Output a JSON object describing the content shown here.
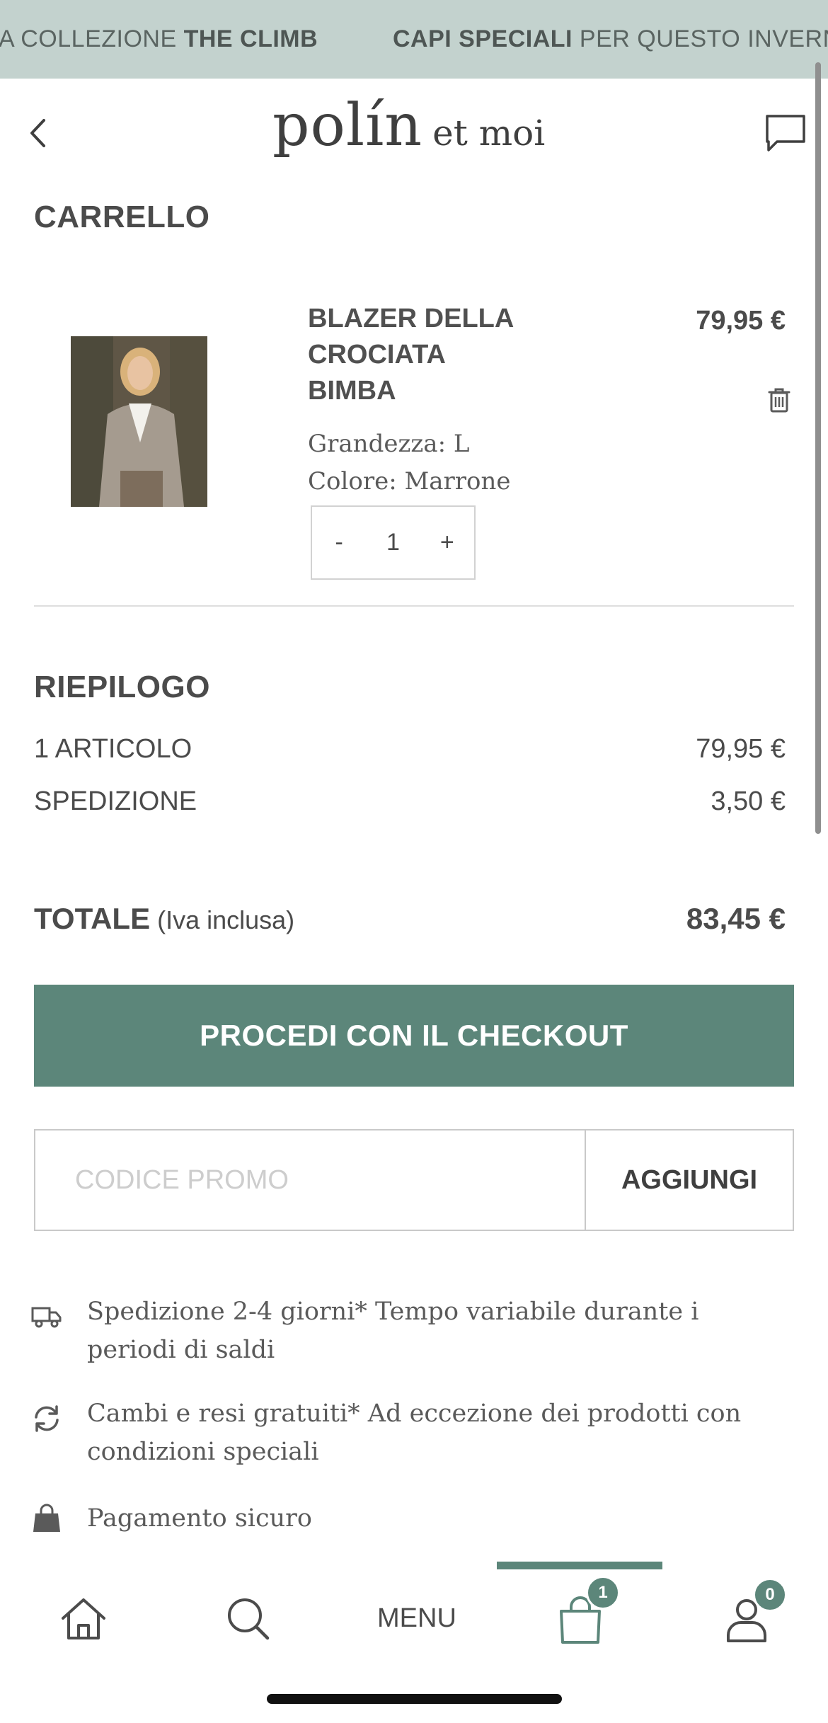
{
  "banner": {
    "left_prefix": "A COLLEZIONE ",
    "left_bold": "THE CLIMB",
    "right_bold": "CAPI SPECIALI",
    "right_suffix": " PER QUESTO INVERNO"
  },
  "header": {
    "logo_main": "polín",
    "logo_sub": "et moi"
  },
  "cart": {
    "title": "CARRELLO",
    "item": {
      "name": "BLAZER DELLA CROCIATA BIMBA",
      "price": "79,95 €",
      "size": "Grandezza: L",
      "color": "Colore: Marrone",
      "qty_minus": "-",
      "qty": "1",
      "qty_plus": "+"
    }
  },
  "summary": {
    "title": "RIEPILOGO",
    "items_label": "1 ARTICOLO",
    "items_value": "79,95 €",
    "shipping_label": "SPEDIZIONE",
    "shipping_value": "3,50 €",
    "total_label": "TOTALE",
    "total_note": " (Iva inclusa)",
    "total_value": "83,45 €"
  },
  "checkout": {
    "label": "PROCEDI CON IL CHECKOUT"
  },
  "promo": {
    "placeholder": "CODICE PROMO",
    "button": "AGGIUNGI"
  },
  "info": {
    "shipping": "Spedizione 2-4 giorni* Tempo variabile durante i periodi di saldi",
    "returns": "Cambi e resi gratuiti* Ad eccezione dei prodotti con condizioni speciali",
    "payment": "Pagamento sicuro"
  },
  "nav": {
    "menu_label": "MENU",
    "cart_badge": "1",
    "account_badge": "0"
  },
  "colors": {
    "accent": "#5c867a",
    "banner_bg": "#c3d2ce"
  }
}
